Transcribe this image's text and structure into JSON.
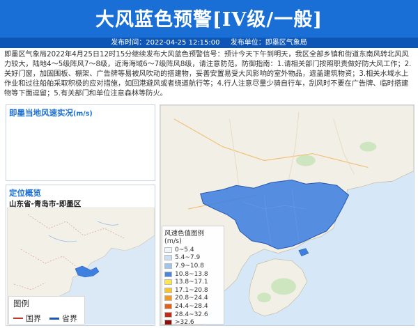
{
  "header": {
    "title": "大风蓝色预警[IV级/一般]",
    "publish_time": "发布时间：2022-04-25 12:15:00",
    "publish_unit": "发布单位：即墨区气象局"
  },
  "notice": {
    "text": "即墨区气象局2022年4月25日12时15分继续发布大风蓝色预警信号：预计今天下午到明天，我区全部乡镇和街道东南风转北风风力较大，陆地4～5级阵风7～8级，近海海域6～7级阵风8级，请注意防范。防御指南：1.请相关部门按照职责做好防大风工作；2.关好门窗，加固围板、棚架、广告牌等易被风吹动的搭建物，妥善安置易受大风影响的室外物品，遮盖建筑物资；3.相关水域水上作业和过往船舶采取积极的应对措施，如回港避风或者绕道航行等；4.行人注意尽量少骑自行车，刮风时不要在广告牌、临时搭建物等下面逗留；5.有关部门和单位注意森林等防火。"
  },
  "wind_panel": {
    "title": "即墨当地风速实况",
    "unit": "(m/s)"
  },
  "location_panel": {
    "title": "定位概览",
    "region": "山东省-青岛市-即墨区"
  },
  "map_legend": {
    "title": "图例",
    "items": [
      {
        "label": "国界",
        "color": "#c0392b"
      },
      {
        "label": "省界",
        "color": "#1a56b5"
      }
    ]
  },
  "speed_legend": {
    "title": "风速色值图例 (m/s)",
    "items": [
      {
        "label": "0~5.4",
        "color": "#eef5fb"
      },
      {
        "label": "5.4~7.9",
        "color": "#c9e0f4"
      },
      {
        "label": "7.9~10.8",
        "color": "#9cc6ee"
      },
      {
        "label": "10.8~13.8",
        "color": "#4b86dc"
      },
      {
        "label": "13.8~17.1",
        "color": "#fde64b"
      },
      {
        "label": "17.1~20.8",
        "color": "#f7c530"
      },
      {
        "label": "20.8~24.4",
        "color": "#f39a1e"
      },
      {
        "label": "24.4~28.4",
        "color": "#e35f17"
      },
      {
        "label": "28.4~32.6",
        "color": "#c72a12"
      },
      {
        "label": ">32.6",
        "color": "#8b1008"
      }
    ]
  },
  "colors": {
    "header_bg": "#1a6fd6",
    "subbar_bg": "#0d56b5",
    "warning_region": "#3f7fe0",
    "sea": "#d6e8f7",
    "land": "#f2efe6"
  }
}
